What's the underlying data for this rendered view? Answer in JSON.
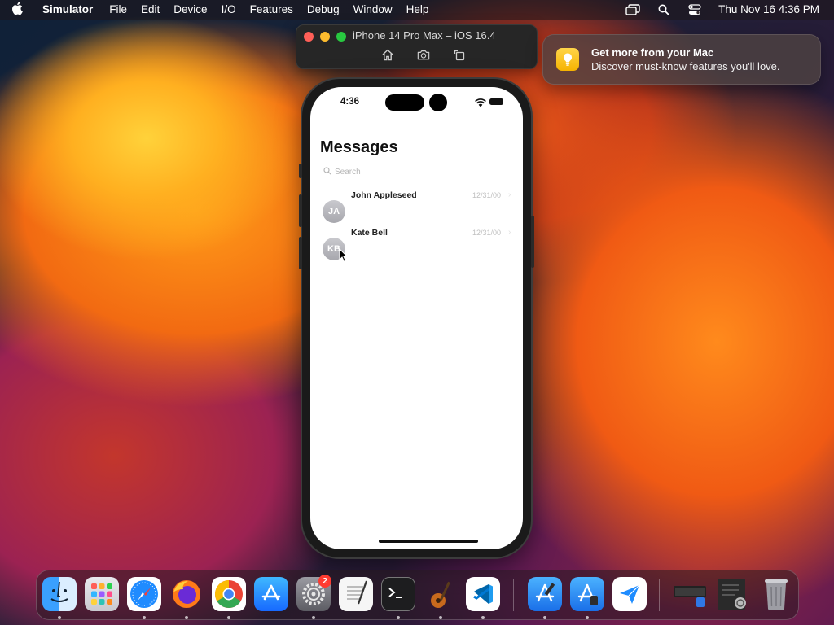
{
  "menubar": {
    "app_name": "Simulator",
    "items": [
      "File",
      "Edit",
      "Device",
      "I/O",
      "Features",
      "Debug",
      "Window",
      "Help"
    ],
    "clock": "Thu Nov 16  4:36 PM"
  },
  "simulator_window": {
    "title": "iPhone 14 Pro Max – iOS 16.4",
    "tools": [
      "home-icon",
      "screenshot-icon",
      "rotate-icon"
    ]
  },
  "notification": {
    "title": "Get more from your Mac",
    "body": "Discover must-know features you'll love."
  },
  "phone": {
    "status_time": "4:36",
    "screen_title": "Messages",
    "search_placeholder": "Search",
    "conversations": [
      {
        "initials": "JA",
        "name": "John Appleseed",
        "date": "12/31/00"
      },
      {
        "initials": "KB",
        "name": "Kate Bell",
        "date": "12/31/00"
      }
    ]
  },
  "dock": {
    "apps": [
      "Finder",
      "Launchpad",
      "Safari",
      "Firefox",
      "Chrome",
      "App Store",
      "System Settings",
      "TextEdit",
      "Terminal",
      "Instruments",
      "Visual Studio Code",
      "Xcode",
      "Simulator",
      "Testflight",
      "Screenshot Folder",
      "Recent Document",
      "Trash"
    ],
    "settings_badge": "2"
  },
  "colors": {
    "accent_blue": "#0a84ff",
    "notification_bg": "#4e4242",
    "badge_red": "#ff3b30"
  }
}
